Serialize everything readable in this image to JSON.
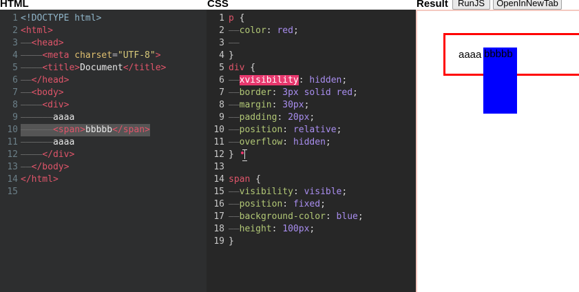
{
  "html_panel": {
    "title": "HTML",
    "lines": [
      {
        "num": "1",
        "parts": [
          {
            "t": "<!DOCTYPE html>",
            "c": "doctype"
          }
        ]
      },
      {
        "num": "2",
        "parts": [
          {
            "t": "<html>",
            "c": "tag"
          }
        ]
      },
      {
        "num": "3",
        "parts": [
          {
            "t": "——",
            "c": "indent"
          },
          {
            "t": "<head>",
            "c": "tag"
          }
        ]
      },
      {
        "num": "4",
        "parts": [
          {
            "t": "————",
            "c": "indent"
          },
          {
            "t": "<meta ",
            "c": "tag"
          },
          {
            "t": "charset",
            "c": "attr"
          },
          {
            "t": "=",
            "c": "punct"
          },
          {
            "t": "\"UTF-8\"",
            "c": "str"
          },
          {
            "t": ">",
            "c": "tag"
          }
        ]
      },
      {
        "num": "5",
        "parts": [
          {
            "t": "————",
            "c": "indent"
          },
          {
            "t": "<title>",
            "c": "tag"
          },
          {
            "t": "Document",
            "c": "text"
          },
          {
            "t": "</title>",
            "c": "tag"
          }
        ]
      },
      {
        "num": "6",
        "parts": [
          {
            "t": "——",
            "c": "indent"
          },
          {
            "t": "</head>",
            "c": "tag"
          }
        ]
      },
      {
        "num": "7",
        "parts": [
          {
            "t": "——",
            "c": "indent"
          },
          {
            "t": "<body>",
            "c": "tag"
          }
        ]
      },
      {
        "num": "8",
        "parts": [
          {
            "t": "————",
            "c": "indent"
          },
          {
            "t": "<div>",
            "c": "tag"
          }
        ]
      },
      {
        "num": "9",
        "parts": [
          {
            "t": "——————",
            "c": "indent"
          },
          {
            "t": "aaaa",
            "c": "text"
          }
        ]
      },
      {
        "num": "10",
        "highlight": true,
        "parts": [
          {
            "t": "——————",
            "c": "indent"
          },
          {
            "t": "<span>",
            "c": "tag"
          },
          {
            "t": "bbbbb",
            "c": "text"
          },
          {
            "t": "</span>",
            "c": "tag"
          }
        ]
      },
      {
        "num": "11",
        "parts": [
          {
            "t": "——————",
            "c": "indent"
          },
          {
            "t": "aaaa",
            "c": "text"
          }
        ]
      },
      {
        "num": "12",
        "parts": [
          {
            "t": "————",
            "c": "indent"
          },
          {
            "t": "</div>",
            "c": "tag"
          }
        ]
      },
      {
        "num": "13",
        "parts": [
          {
            "t": "——",
            "c": "indent"
          },
          {
            "t": "</body>",
            "c": "tag"
          }
        ]
      },
      {
        "num": "14",
        "parts": [
          {
            "t": "</html>",
            "c": "tag"
          }
        ]
      },
      {
        "num": "15",
        "parts": []
      }
    ]
  },
  "css_panel": {
    "title": "CSS",
    "lines": [
      {
        "num": "1",
        "parts": [
          {
            "t": "p",
            "c": "sel"
          },
          {
            "t": " {",
            "c": "brace"
          }
        ]
      },
      {
        "num": "2",
        "parts": [
          {
            "t": "——",
            "c": "indent"
          },
          {
            "t": "color",
            "c": "prop"
          },
          {
            "t": ": ",
            "c": "brace"
          },
          {
            "t": "red",
            "c": "val"
          },
          {
            "t": ";",
            "c": "brace"
          }
        ]
      },
      {
        "num": "3",
        "parts": [
          {
            "t": "——",
            "c": "indent"
          }
        ]
      },
      {
        "num": "4",
        "parts": [
          {
            "t": "}",
            "c": "brace"
          }
        ]
      },
      {
        "num": "5",
        "parts": [
          {
            "t": "div",
            "c": "sel"
          },
          {
            "t": " {",
            "c": "brace"
          }
        ]
      },
      {
        "num": "6",
        "parts": [
          {
            "t": "——",
            "c": "indent"
          },
          {
            "t": "xvisibility",
            "c": "err"
          },
          {
            "t": ": ",
            "c": "brace"
          },
          {
            "t": "hidden",
            "c": "val"
          },
          {
            "t": ";",
            "c": "brace"
          }
        ]
      },
      {
        "num": "7",
        "parts": [
          {
            "t": "——",
            "c": "indent"
          },
          {
            "t": "border",
            "c": "prop"
          },
          {
            "t": ": ",
            "c": "brace"
          },
          {
            "t": "3px solid red",
            "c": "val"
          },
          {
            "t": ";",
            "c": "brace"
          }
        ]
      },
      {
        "num": "8",
        "parts": [
          {
            "t": "——",
            "c": "indent"
          },
          {
            "t": "margin",
            "c": "prop"
          },
          {
            "t": ": ",
            "c": "brace"
          },
          {
            "t": "30px",
            "c": "val"
          },
          {
            "t": ";",
            "c": "brace"
          }
        ]
      },
      {
        "num": "9",
        "parts": [
          {
            "t": "——",
            "c": "indent"
          },
          {
            "t": "padding",
            "c": "prop"
          },
          {
            "t": ": ",
            "c": "brace"
          },
          {
            "t": "20px",
            "c": "val"
          },
          {
            "t": ";",
            "c": "brace"
          }
        ]
      },
      {
        "num": "10",
        "parts": [
          {
            "t": "——",
            "c": "indent"
          },
          {
            "t": "position",
            "c": "prop"
          },
          {
            "t": ": ",
            "c": "brace"
          },
          {
            "t": "relative",
            "c": "val"
          },
          {
            "t": ";",
            "c": "brace"
          }
        ]
      },
      {
        "num": "11",
        "parts": [
          {
            "t": "——",
            "c": "indent"
          },
          {
            "t": "overflow",
            "c": "prop"
          },
          {
            "t": ": ",
            "c": "brace"
          },
          {
            "t": "hidden",
            "c": "val"
          },
          {
            "t": ";",
            "c": "brace"
          }
        ]
      },
      {
        "num": "12",
        "cursor": true,
        "parts": [
          {
            "t": "}",
            "c": "brace"
          }
        ]
      },
      {
        "num": "13",
        "parts": []
      },
      {
        "num": "14",
        "parts": [
          {
            "t": "span",
            "c": "sel"
          },
          {
            "t": " {",
            "c": "brace"
          }
        ]
      },
      {
        "num": "15",
        "parts": [
          {
            "t": "——",
            "c": "indent"
          },
          {
            "t": "visibility",
            "c": "prop"
          },
          {
            "t": ": ",
            "c": "brace"
          },
          {
            "t": "visible",
            "c": "val"
          },
          {
            "t": ";",
            "c": "brace"
          }
        ]
      },
      {
        "num": "16",
        "parts": [
          {
            "t": "——",
            "c": "indent"
          },
          {
            "t": "position",
            "c": "prop"
          },
          {
            "t": ": ",
            "c": "brace"
          },
          {
            "t": "fixed",
            "c": "val"
          },
          {
            "t": ";",
            "c": "brace"
          }
        ]
      },
      {
        "num": "17",
        "parts": [
          {
            "t": "——",
            "c": "indent"
          },
          {
            "t": "background-color",
            "c": "prop"
          },
          {
            "t": ": ",
            "c": "brace"
          },
          {
            "t": "blue",
            "c": "val"
          },
          {
            "t": ";",
            "c": "brace"
          }
        ]
      },
      {
        "num": "18",
        "parts": [
          {
            "t": "——",
            "c": "indent"
          },
          {
            "t": "height",
            "c": "prop"
          },
          {
            "t": ": ",
            "c": "brace"
          },
          {
            "t": "100px",
            "c": "val"
          },
          {
            "t": ";",
            "c": "brace"
          }
        ]
      },
      {
        "num": "19",
        "parts": [
          {
            "t": "}",
            "c": "brace"
          }
        ]
      }
    ]
  },
  "result_panel": {
    "title": "Result",
    "run_label": "RunJS",
    "newtab_label": "OpenInNewTab",
    "preview": {
      "div_text": "aaaa",
      "span_text": "bbbbb",
      "div_border_color": "#ff0000",
      "span_background": "#0000ff"
    }
  },
  "colors": {
    "html_editor_bg": "#2d2e2f",
    "css_editor_bg": "#272727",
    "error_highlight": "#e8386e"
  }
}
